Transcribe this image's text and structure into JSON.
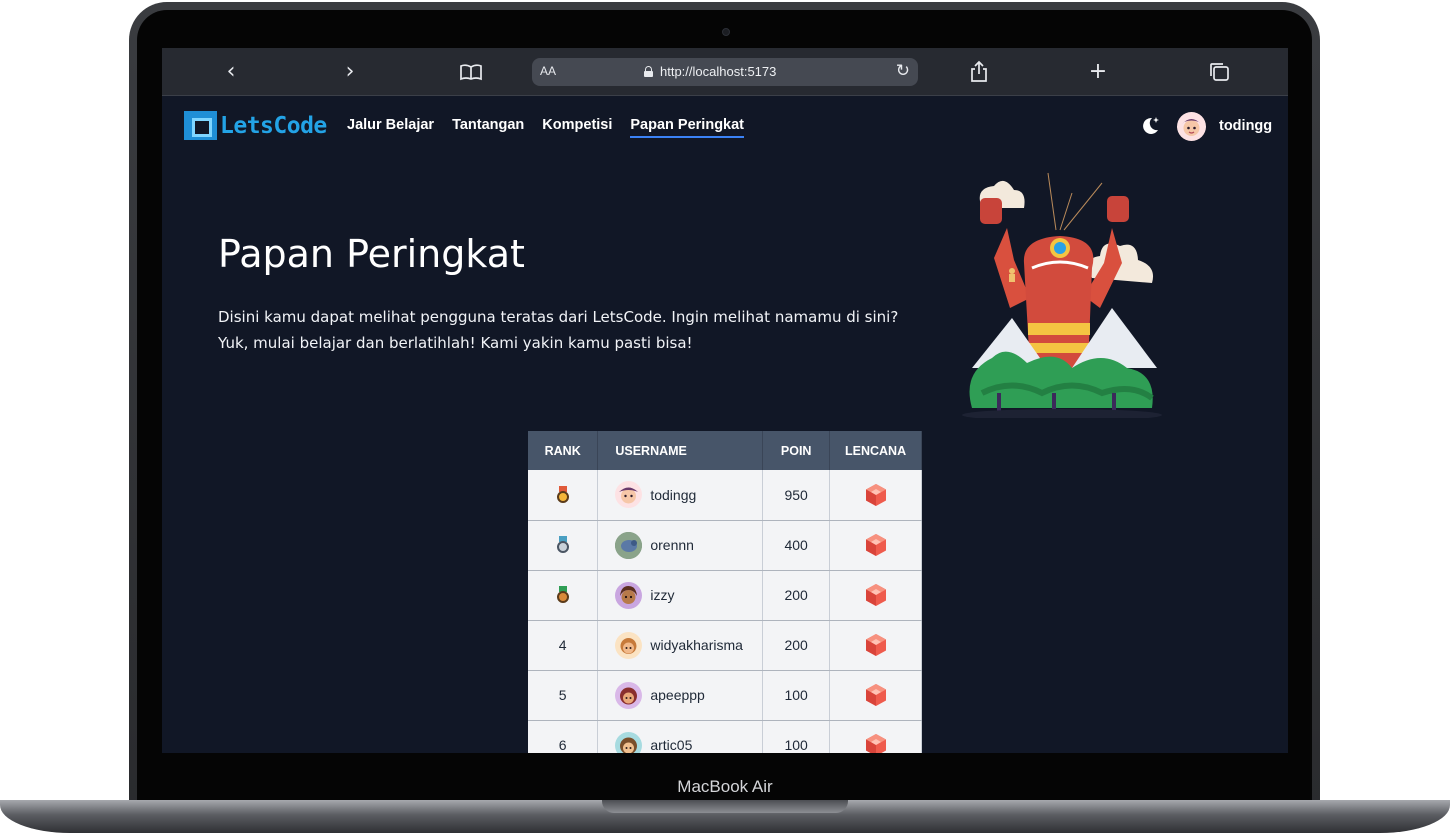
{
  "device": {
    "label": "MacBook Air"
  },
  "browser": {
    "text_size_label": "AA",
    "url": "http://localhost:5173"
  },
  "navbar": {
    "logo_text": "LetsCode",
    "links": [
      {
        "label": "Jalur Belajar",
        "active": false
      },
      {
        "label": "Tantangan",
        "active": false
      },
      {
        "label": "Kompetisi",
        "active": false
      },
      {
        "label": "Papan Peringkat",
        "active": true
      }
    ],
    "username": "todingg"
  },
  "hero": {
    "title": "Papan Peringkat",
    "description": "Disini kamu dapat melihat pengguna teratas dari LetsCode. Ingin melihat namamu di sini? Yuk, mulai belajar dan berlatihlah! Kami yakin kamu pasti bisa!"
  },
  "leaderboard": {
    "columns": [
      "RANK",
      "USERNAME",
      "POIN",
      "LENCANA"
    ],
    "rows": [
      {
        "rank": "",
        "medal": "gold",
        "username": "todingg",
        "points": "950",
        "avatar_color": "#fde2e4"
      },
      {
        "rank": "",
        "medal": "silver",
        "username": "orennn",
        "points": "400",
        "avatar_color": "#6b8a6a"
      },
      {
        "rank": "",
        "medal": "bronze",
        "username": "izzy",
        "points": "200",
        "avatar_color": "#c9a6e0"
      },
      {
        "rank": "4",
        "medal": "",
        "username": "widyakharisma",
        "points": "200",
        "avatar_color": "#fbe3c3"
      },
      {
        "rank": "5",
        "medal": "",
        "username": "apeeppp",
        "points": "100",
        "avatar_color": "#d9b8e8"
      },
      {
        "rank": "6",
        "medal": "",
        "username": "artic05",
        "points": "100",
        "avatar_color": "#a7dbe0"
      }
    ]
  },
  "colors": {
    "page_bg": "#111726",
    "accent": "#3b82f6",
    "table_header": "#475569",
    "badge": "#ef5b4d"
  }
}
